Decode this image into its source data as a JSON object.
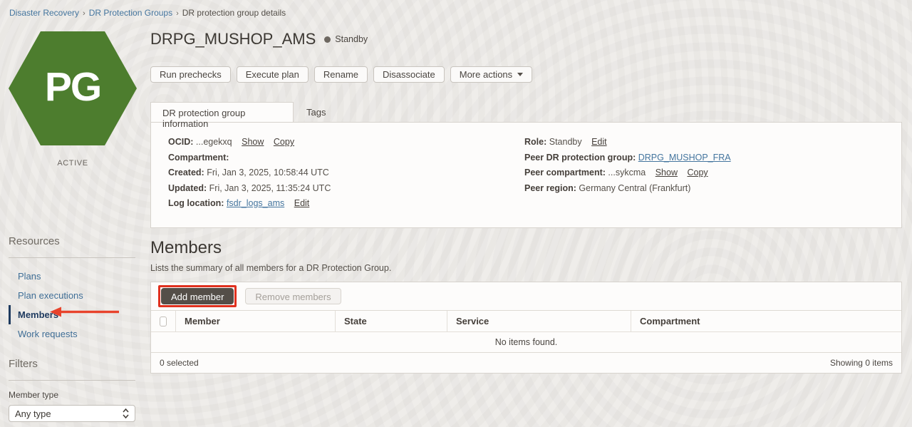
{
  "breadcrumb": {
    "separator": "›",
    "items": [
      {
        "label": "Disaster Recovery"
      },
      {
        "label": "DR Protection Groups"
      },
      {
        "label": "DR protection group details"
      }
    ]
  },
  "entity": {
    "icon_text": "PG",
    "lifecycle_state": "ACTIVE",
    "title": "DRPG_MUSHOP_AMS",
    "role_badge": "Standby"
  },
  "actions": {
    "run_prechecks": "Run prechecks",
    "execute_plan": "Execute plan",
    "rename": "Rename",
    "disassociate": "Disassociate",
    "more_actions": "More actions"
  },
  "tabs": {
    "info": "DR protection group information",
    "tags": "Tags"
  },
  "info": {
    "ocid": {
      "label": "OCID:",
      "value": "...egekxq",
      "show": "Show",
      "copy": "Copy"
    },
    "compartment": {
      "label": "Compartment:",
      "value": ""
    },
    "created": {
      "label": "Created:",
      "value": "Fri, Jan 3, 2025, 10:58:44 UTC"
    },
    "updated": {
      "label": "Updated:",
      "value": "Fri, Jan 3, 2025, 11:35:24 UTC"
    },
    "log_location": {
      "label": "Log location:",
      "link": "fsdr_logs_ams",
      "edit": "Edit"
    },
    "role": {
      "label": "Role:",
      "value": "Standby",
      "edit": "Edit"
    },
    "peer_group": {
      "label": "Peer DR protection group:",
      "link": "DRPG_MUSHOP_FRA"
    },
    "peer_compartment": {
      "label": "Peer compartment:",
      "value": "...sykcma",
      "show": "Show",
      "copy": "Copy"
    },
    "peer_region": {
      "label": "Peer region:",
      "value": "Germany Central (Frankfurt)"
    }
  },
  "members": {
    "heading": "Members",
    "description": "Lists the summary of all members for a DR Protection Group.",
    "add_button": "Add member",
    "remove_button": "Remove members",
    "columns": [
      "Member",
      "State",
      "Service",
      "Compartment"
    ],
    "empty_text": "No items found.",
    "selected_text": "0 selected",
    "showing_text": "Showing 0 items"
  },
  "sidebar": {
    "resources_heading": "Resources",
    "items": [
      {
        "label": "Plans"
      },
      {
        "label": "Plan executions"
      },
      {
        "label": "Members"
      },
      {
        "label": "Work requests"
      }
    ],
    "filters_heading": "Filters",
    "member_type_label": "Member type",
    "member_type_value": "Any type"
  },
  "colors": {
    "hexagon_green": "#4d7d2e",
    "annotation_red": "#e0301e",
    "link_blue": "#44759e",
    "active_nav": "#1e3a5f",
    "dark_button": "#544e48",
    "page_background": "#edebe8"
  }
}
